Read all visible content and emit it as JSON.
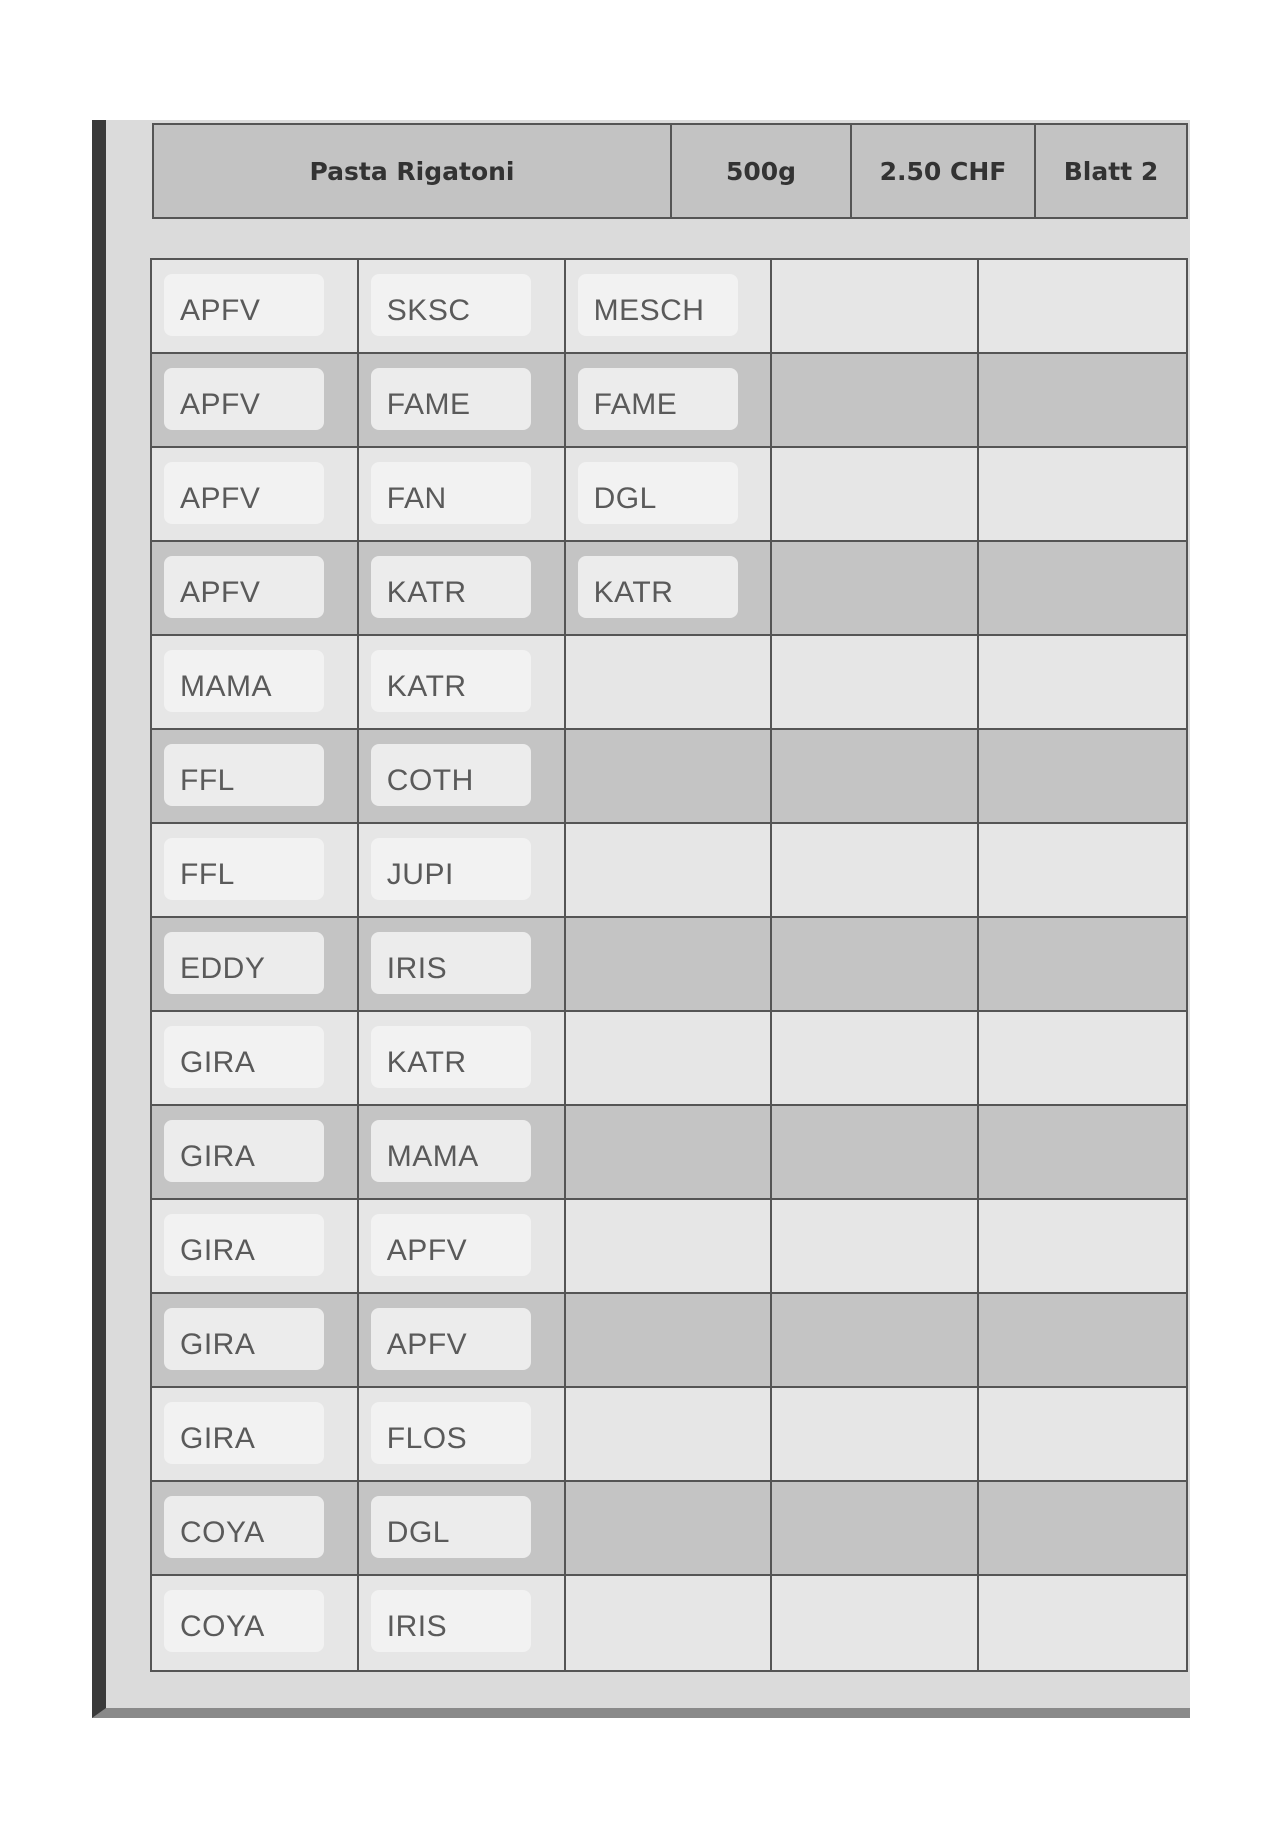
{
  "header": {
    "product": "Pasta Rigatoni",
    "quantity": "500g",
    "price": "2.50 CHF",
    "sheet": "Blatt 2"
  },
  "rows": [
    [
      "APFV",
      "SKSC",
      "MESCH",
      "",
      ""
    ],
    [
      "APFV",
      "FAME",
      "FAME",
      "",
      ""
    ],
    [
      "APFV",
      "FAN",
      "DGL",
      "",
      ""
    ],
    [
      "APFV",
      "KATR",
      "KATR",
      "",
      ""
    ],
    [
      "MAMA",
      "KATR",
      "",
      "",
      ""
    ],
    [
      "FFL",
      "COTH",
      "",
      "",
      ""
    ],
    [
      "FFL",
      "JUPI",
      "",
      "",
      ""
    ],
    [
      "EDDY",
      "IRIS",
      "",
      "",
      ""
    ],
    [
      "GIRA",
      "KATR",
      "",
      "",
      ""
    ],
    [
      "GIRA",
      "MAMA",
      "",
      "",
      ""
    ],
    [
      "GIRA",
      "APFV",
      "",
      "",
      ""
    ],
    [
      "GIRA",
      "APFV",
      "",
      "",
      ""
    ],
    [
      "GIRA",
      "FLOS",
      "",
      "",
      ""
    ],
    [
      "COYA",
      "DGL",
      "",
      "",
      ""
    ],
    [
      "COYA",
      "IRIS",
      "",
      "",
      ""
    ]
  ]
}
